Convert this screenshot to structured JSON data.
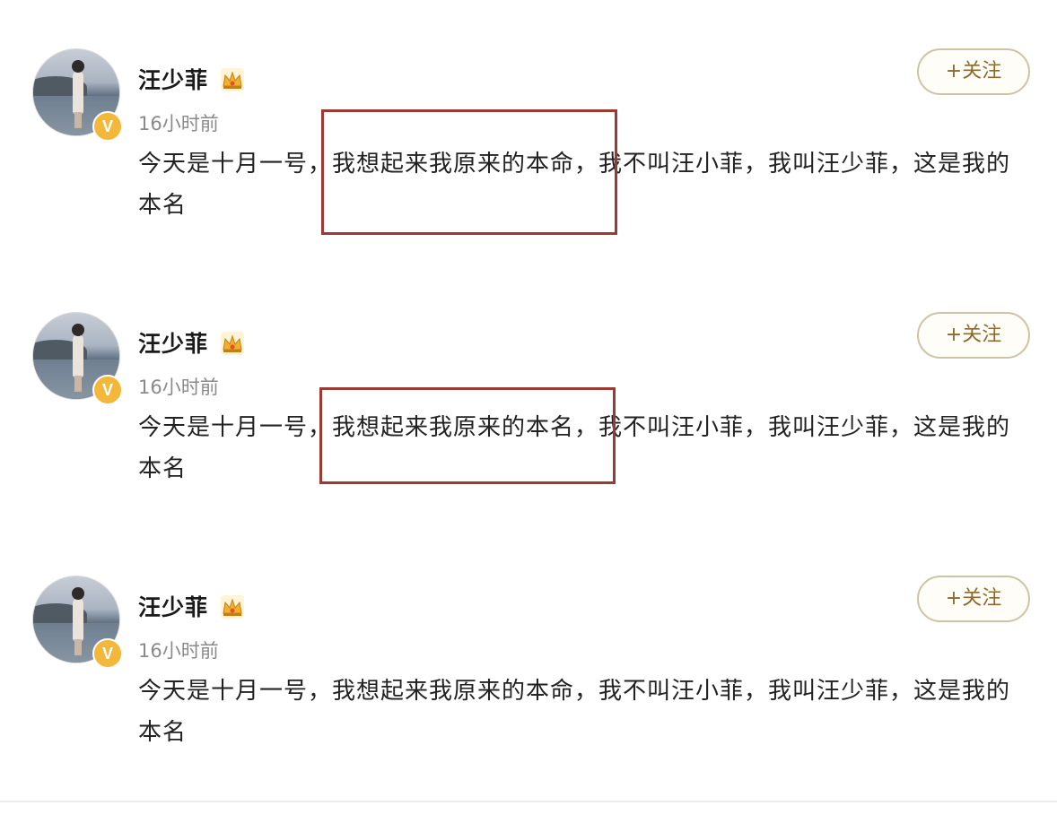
{
  "posts": [
    {
      "username": "汪少菲",
      "timestamp": "16小时前",
      "content": "今天是十月一号，我想起来我原来的本命，我不叫汪小菲，我叫汪少菲，这是我的本名",
      "follow_label": "+关注",
      "verified_badge": "V",
      "highlighted": true
    },
    {
      "username": "汪少菲",
      "timestamp": "16小时前",
      "content": "今天是十月一号，我想起来我原来的本名，我不叫汪小菲，我叫汪少菲，这是我的本名",
      "follow_label": "+关注",
      "verified_badge": "V",
      "highlighted": true
    },
    {
      "username": "汪少菲",
      "timestamp": "16小时前",
      "content": "今天是十月一号，我想起来我原来的本命，我不叫汪小菲，我叫汪少菲，这是我的本名",
      "follow_label": "+关注",
      "verified_badge": "V",
      "highlighted": false
    }
  ],
  "icons": {
    "crown": "crown-icon",
    "verified": "verified-icon"
  },
  "colors": {
    "highlight_border": "#9b3a33",
    "follow_text": "#8b6a2e",
    "follow_border": "#cfc3a5",
    "verified_badge": "#f3b73a"
  }
}
